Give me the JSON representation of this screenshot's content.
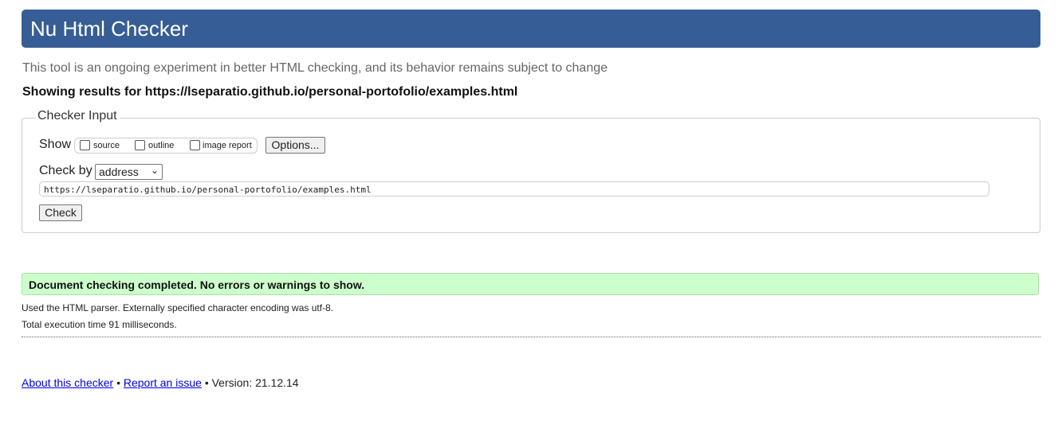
{
  "header": {
    "title": "Nu Html Checker"
  },
  "subtitle": "This tool is an ongoing experiment in better HTML checking, and its behavior remains subject to change",
  "showing": "Showing results for https://lseparatio.github.io/personal-portofolio/examples.html",
  "form": {
    "legend": "Checker Input",
    "show_label": "Show",
    "show_options": [
      {
        "label": "source",
        "checked": false
      },
      {
        "label": "outline",
        "checked": false
      },
      {
        "label": "image report",
        "checked": false
      }
    ],
    "options_button": "Options...",
    "check_by_label": "Check by",
    "check_by_value": "address",
    "url_value": "https://lseparatio.github.io/personal-portofolio/examples.html",
    "check_button": "Check"
  },
  "result": {
    "message": "Document checking completed. No errors or warnings to show.",
    "parser_note": "Used the HTML parser. Externally specified character encoding was utf-8.",
    "exec_time": "Total execution time 91 milliseconds.",
    "success_color": "#ccffcc"
  },
  "footer": {
    "about": "About this checker",
    "sep": "•",
    "report": "Report an issue",
    "version": "• Version: 21.12.14"
  },
  "colors": {
    "header": "#365d95"
  }
}
